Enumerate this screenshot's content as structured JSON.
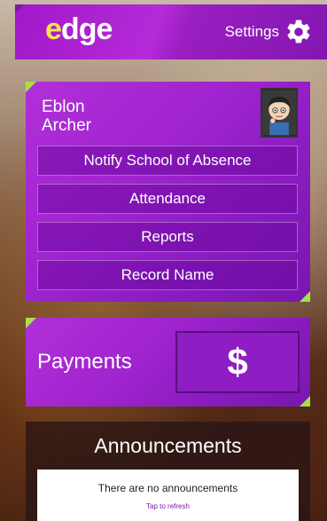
{
  "header": {
    "logo": "edge",
    "settings_label": "Settings"
  },
  "profile": {
    "first_name": "Eblon",
    "last_name": "Archer",
    "menu": [
      {
        "label": "Notify School of Absence"
      },
      {
        "label": "Attendance"
      },
      {
        "label": "Reports"
      },
      {
        "label": "Record Name"
      }
    ]
  },
  "payments": {
    "label": "Payments",
    "button_symbol": "$"
  },
  "announcements": {
    "title": "Announcements",
    "empty_text": "There are no announcements",
    "refresh_text": "Tap to refresh"
  },
  "colors": {
    "brand_purple": "#a024cf",
    "accent_green": "#a6e04a",
    "logo_yellow": "#f5e64a"
  }
}
